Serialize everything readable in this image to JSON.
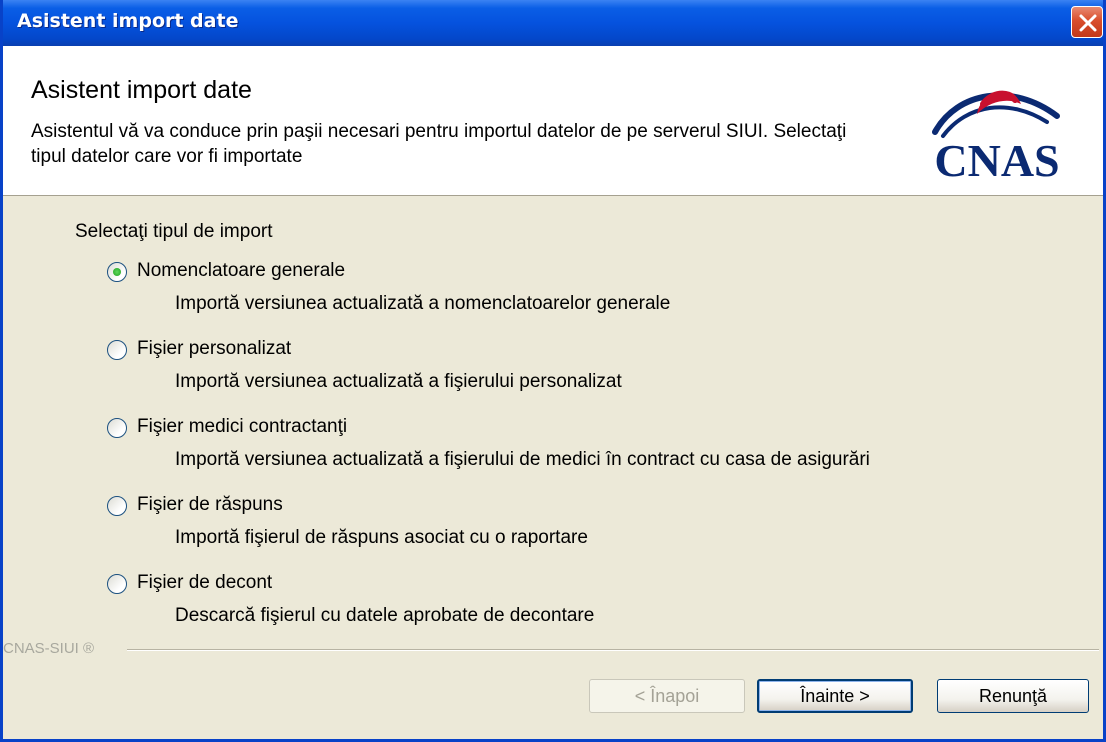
{
  "window": {
    "title": "Asistent import date"
  },
  "header": {
    "title": "Asistent import date",
    "description": "Asistentul vă va conduce prin paşii necesari pentru importul datelor de pe serverul SIUI. Selectaţi tipul datelor care vor fi importate",
    "logo_text": "CNAS"
  },
  "import_group": {
    "label": "Selectaţi tipul de import",
    "options": [
      {
        "label": "Nomenclatoare generale",
        "description": "Importă versiunea actualizată a nomenclatoarelor generale",
        "checked": true
      },
      {
        "label": "Fişier personalizat",
        "description": "Importă versiunea actualizată a fişierului personalizat",
        "checked": false
      },
      {
        "label": "Fişier medici contractanţi",
        "description": "Importă versiunea actualizată a fişierului de medici în contract cu casa de asigurări",
        "checked": false
      },
      {
        "label": "Fişier de răspuns",
        "description": "Importă fişierul de răspuns asociat cu o raportare",
        "checked": false
      },
      {
        "label": "Fişier de decont",
        "description": "Descarcă fişierul cu datele aprobate de decontare",
        "checked": false
      }
    ]
  },
  "footer": {
    "brand": "CNAS-SIUI ®",
    "back_label": "< Înapoi",
    "next_label": "Înainte >",
    "cancel_label": "Renunţă"
  },
  "colors": {
    "titlebar": "#0552de",
    "dialog_bg": "#ece9d8",
    "logo_red": "#c8102e",
    "logo_blue": "#0b2a72"
  }
}
